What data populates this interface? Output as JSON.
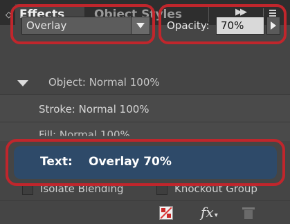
{
  "tabs": {
    "effects": "Effects",
    "object_styles": "Object Styles"
  },
  "header_icons": [
    "sort-arrows-icon",
    "collapse-panel-icon",
    "panel-menu-icon"
  ],
  "blend_mode": {
    "value": "Overlay"
  },
  "opacity": {
    "label": "Opacity:",
    "value": "70%"
  },
  "levels": [
    {
      "name": "Object:",
      "value": "Normal 100%"
    },
    {
      "name": "Stroke:",
      "value": "Normal 100%"
    },
    {
      "name": "Fill:",
      "value": "Normal 100%"
    },
    {
      "name": "Text:",
      "value": "Overlay 70%"
    }
  ],
  "options": {
    "isolate": "Isolate Blending",
    "knockout": "Knockout Group"
  },
  "toolbar_icons": [
    "clear-effects-icon",
    "fx-icon",
    "trash-icon"
  ],
  "colors": {
    "highlight": "#c0262c",
    "selected_row": "#2e4a69"
  }
}
